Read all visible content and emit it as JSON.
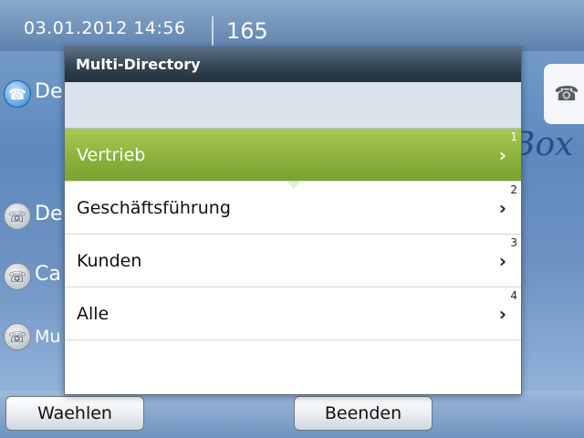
{
  "status": {
    "datetime": "03.01.2012 14:56",
    "extension": "165"
  },
  "background_rows": [
    {
      "text": "De",
      "icon": "phone-hangup-icon"
    },
    {
      "text": "De",
      "icon": "phone-ring-icon"
    },
    {
      "text": "Ca",
      "icon": "phone-ring-icon"
    },
    {
      "text": "Mu",
      "icon": "phone-ring-icon"
    }
  ],
  "background_right_text": "Box",
  "dialog": {
    "title": "Multi-Directory",
    "items": [
      {
        "label": "Vertrieb",
        "number": "1",
        "selected": true
      },
      {
        "label": "Geschäftsführung",
        "number": "2",
        "selected": false
      },
      {
        "label": "Kunden",
        "number": "3",
        "selected": false
      },
      {
        "label": "Alle",
        "number": "4",
        "selected": false
      }
    ]
  },
  "buttons": {
    "dial": "Waehlen",
    "end": "Beenden"
  },
  "colors": {
    "selected_item": "#8cb23c",
    "title_bar": "#324453"
  }
}
